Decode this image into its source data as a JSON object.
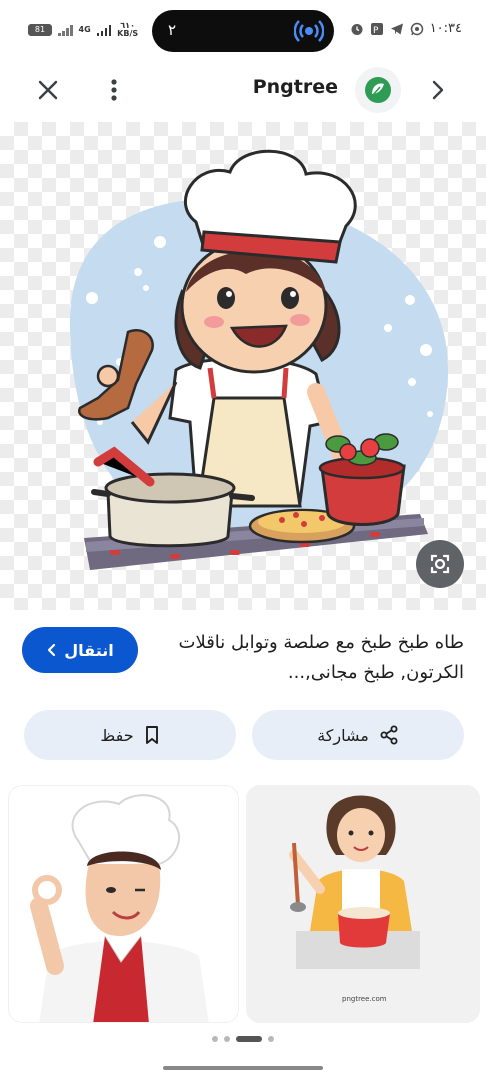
{
  "status_bar": {
    "battery": "81",
    "network": "4G",
    "speed_value": "٦١٠",
    "speed_unit": "KB/S",
    "pill_number": "٢",
    "time": "١٠:٣٤"
  },
  "app_bar": {
    "site_name": "Pngtree",
    "brand_color": "#2e9c55"
  },
  "result": {
    "title": "طاه طبخ طبخ مع صلصة وتوابل ناقلات الكرتون, طبخ مجانى,...",
    "visit_label": "انتقال",
    "accent_color": "#0b57d0"
  },
  "actions": {
    "share_label": "مشاركة",
    "save_label": "حفظ"
  },
  "related": {
    "right_caption": "pngtree.com"
  },
  "pager": {
    "count": 4,
    "active": 2
  }
}
